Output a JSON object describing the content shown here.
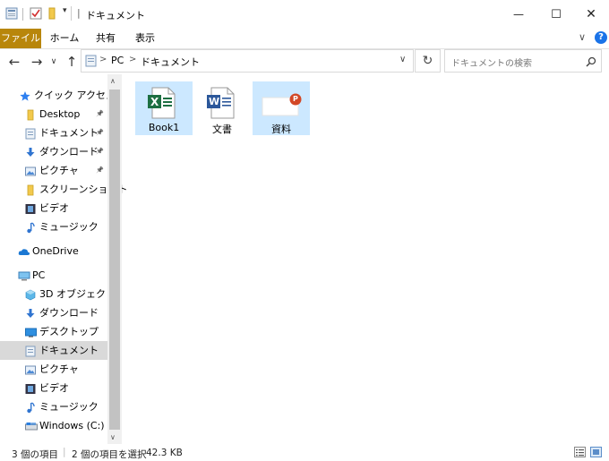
{
  "window": {
    "title": "ドキュメント",
    "minimize_glyph": "—",
    "maximize_glyph": "☐",
    "close_glyph": "✕"
  },
  "ribbon": {
    "tabs": [
      "ファイル",
      "ホーム",
      "共有",
      "表示"
    ],
    "expand_glyph": "∨",
    "help_glyph": "?"
  },
  "address": {
    "segments": [
      "PC",
      "ドキュメント"
    ],
    "separator": ">",
    "search_placeholder": "ドキュメントの検索"
  },
  "sidebar": {
    "items": [
      {
        "label": "クイック アクセス",
        "icon": "star-icon",
        "pinned": false
      },
      {
        "label": "Desktop",
        "icon": "folder-icon",
        "pinned": true
      },
      {
        "label": "ドキュメント",
        "icon": "documents-icon",
        "pinned": true
      },
      {
        "label": "ダウンロード",
        "icon": "download-icon",
        "pinned": true
      },
      {
        "label": "ピクチャ",
        "icon": "pictures-icon",
        "pinned": true
      },
      {
        "label": "スクリーンショット",
        "icon": "folder-icon",
        "pinned": false
      },
      {
        "label": "ビデオ",
        "icon": "videos-icon",
        "pinned": false
      },
      {
        "label": "ミュージック",
        "icon": "music-icon",
        "pinned": false
      },
      {
        "label": "OneDrive",
        "icon": "cloud-icon",
        "pinned": false
      },
      {
        "label": "PC",
        "icon": "pc-icon",
        "pinned": false
      },
      {
        "label": "3D オブジェクト",
        "icon": "cube-icon",
        "pinned": false
      },
      {
        "label": "ダウンロード",
        "icon": "download-icon",
        "pinned": false
      },
      {
        "label": "デスクトップ",
        "icon": "desktop-icon",
        "pinned": false
      },
      {
        "label": "ドキュメント",
        "icon": "documents-icon",
        "pinned": false,
        "selected": true
      },
      {
        "label": "ピクチャ",
        "icon": "pictures-icon",
        "pinned": false
      },
      {
        "label": "ビデオ",
        "icon": "videos-icon",
        "pinned": false
      },
      {
        "label": "ミュージック",
        "icon": "music-icon",
        "pinned": false
      },
      {
        "label": "Windows (C:)",
        "icon": "drive-icon",
        "pinned": false
      }
    ]
  },
  "files": [
    {
      "name": "Book1",
      "type": "excel",
      "selected": true,
      "badge": "X"
    },
    {
      "name": "文書",
      "type": "word",
      "selected": false,
      "badge": "W"
    },
    {
      "name": "資料",
      "type": "powerpoint",
      "selected": true,
      "badge": "P"
    }
  ],
  "status": {
    "item_count": "3 個の項目",
    "selected_info": "2 個の項目を選択",
    "size": "42.3 KB"
  },
  "colors": {
    "file_tab": "#b8860b",
    "selection": "#cce8ff",
    "excel": "#1d6f42",
    "word": "#2b579a",
    "powerpoint": "#d24726",
    "help": "#1a73e8"
  }
}
